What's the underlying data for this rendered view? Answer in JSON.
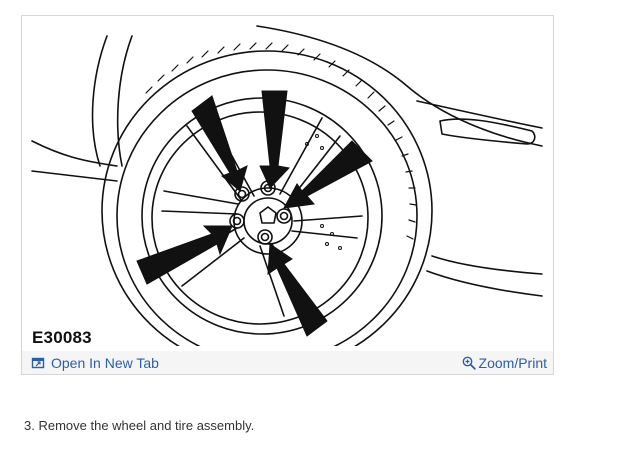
{
  "figure": {
    "id_label": "E30083",
    "open_tab_label": "Open In New Tab",
    "zoom_label": "Zoom/Print",
    "open_tab_icon": "open-in-new-tab-icon",
    "zoom_icon": "magnifier-zoom-icon"
  },
  "instructions": {
    "step_text": "3. Remove the wheel and tire assembly."
  },
  "colors": {
    "link": "#2b5fa8",
    "footer_bg": "#f5f5f5",
    "border": "#d6d6d6"
  }
}
